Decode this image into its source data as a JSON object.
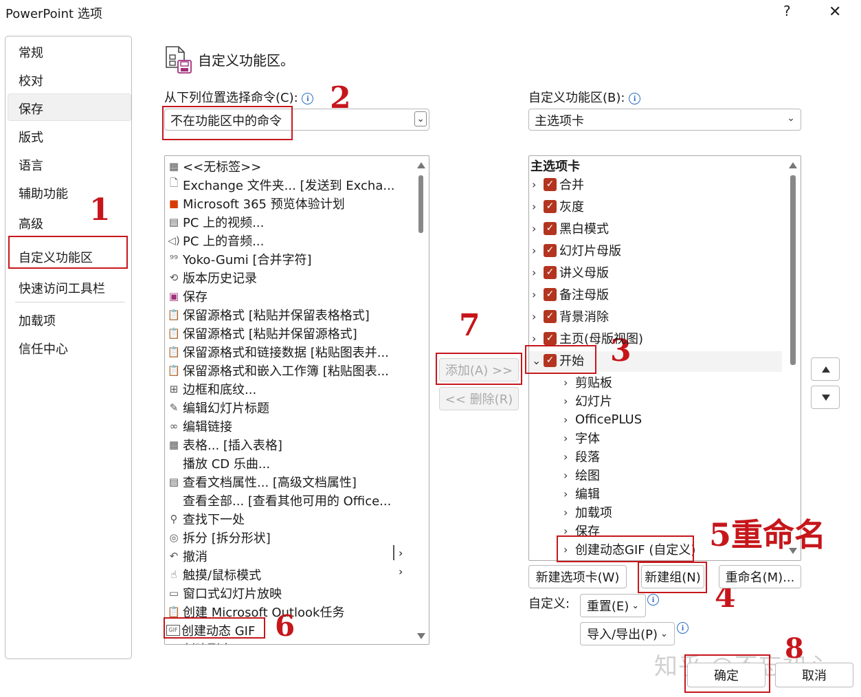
{
  "window": {
    "title": "PowerPoint 选项",
    "help_glyph": "?",
    "close_glyph": "✕"
  },
  "nav": {
    "items": [
      "常规",
      "校对",
      "保存",
      "版式",
      "语言",
      "辅助功能",
      "高级",
      "自定义功能区",
      "快速访问工具栏",
      "加载项",
      "信任中心"
    ]
  },
  "header": {
    "title": "自定义功能区。"
  },
  "left": {
    "choose_label": "从下列位置选择命令(C):",
    "choose_value": "不在功能区中的命令",
    "commands": [
      {
        "icon": "label-icon",
        "glyph": "▦",
        "text": "<<无标签>>"
      },
      {
        "icon": "exchange-icon",
        "glyph": "🗋",
        "text": "Exchange 文件夹... [发送到 Excha..."
      },
      {
        "icon": "office-icon",
        "glyph": "■",
        "text": "Microsoft 365 预览体验计划"
      },
      {
        "icon": "video-icon",
        "glyph": "▤",
        "text": "PC 上的视频..."
      },
      {
        "icon": "audio-icon",
        "glyph": "◁)",
        "text": "PC 上的音频..."
      },
      {
        "icon": "yoko-icon",
        "glyph": "⁹⁹",
        "text": "Yoko-Gumi [合并字符]"
      },
      {
        "icon": "history-icon",
        "glyph": "⟲",
        "text": "版本历史记录"
      },
      {
        "icon": "save-icon",
        "glyph": "▣",
        "text": "保存"
      },
      {
        "icon": "paste-icon",
        "glyph": "📋",
        "text": "保留源格式 [粘贴并保留表格格式]"
      },
      {
        "icon": "paste-icon",
        "glyph": "📋",
        "text": "保留源格式 [粘贴并保留源格式]"
      },
      {
        "icon": "paste-icon",
        "glyph": "📋",
        "text": "保留源格式和链接数据 [粘贴图表并..."
      },
      {
        "icon": "paste-icon",
        "glyph": "📋",
        "text": "保留源格式和嵌入工作簿 [粘贴图表..."
      },
      {
        "icon": "border-icon",
        "glyph": "⊞",
        "text": "边框和底纹..."
      },
      {
        "icon": "edit-title-icon",
        "glyph": "✎",
        "text": "编辑幻灯片标题"
      },
      {
        "icon": "link-icon",
        "glyph": "∞",
        "text": "编辑链接"
      },
      {
        "icon": "table-icon",
        "glyph": "▦",
        "text": "表格... [插入表格]"
      },
      {
        "icon": "none",
        "glyph": "",
        "text": "播放 CD 乐曲..."
      },
      {
        "icon": "properties-icon",
        "glyph": "▤",
        "text": "查看文档属性... [高级文档属性]"
      },
      {
        "icon": "none",
        "glyph": "",
        "text": "查看全部... [查看其他可用的 Office..."
      },
      {
        "icon": "find-icon",
        "glyph": "⚲",
        "text": "查找下一处"
      },
      {
        "icon": "ungroup-icon",
        "glyph": "◎",
        "text": "拆分 [拆分形状]"
      },
      {
        "icon": "undo-icon",
        "glyph": "↶",
        "text": "撤消"
      },
      {
        "icon": "touch-icon",
        "glyph": "☝",
        "text": "触摸/鼠标模式"
      },
      {
        "icon": "slideshow-icon",
        "glyph": "▭",
        "text": "窗口式幻灯片放映"
      },
      {
        "icon": "outlook-task-icon",
        "glyph": "📋",
        "text": "创建 Microsoft Outlook任务"
      },
      {
        "icon": "gif-icon",
        "glyph": "GIF",
        "text": "创建动态 GIF"
      },
      {
        "icon": "none",
        "glyph": "",
        "text": "创建副本"
      }
    ]
  },
  "middle": {
    "add_label": "添加(A) >>",
    "remove_label": "<< 删除(R)"
  },
  "right": {
    "customize_label": "自定义功能区(B):",
    "customize_value": "主选项卡",
    "tree_header": "主选项卡",
    "tabs": [
      "合并",
      "灰度",
      "黑白模式",
      "幻灯片母版",
      "讲义母版",
      "备注母版",
      "背景消除",
      "主页(母版视图)",
      "开始"
    ],
    "groups": [
      "剪贴板",
      "幻灯片",
      "OfficePLUS",
      "字体",
      "段落",
      "绘图",
      "编辑",
      "加载项",
      "保存",
      "创建动态GIF (自定义)"
    ],
    "new_tab": "新建选项卡(W)",
    "new_group": "新建组(N)",
    "rename": "重命名(M)...",
    "customize_caption": "自定义:",
    "reset": "重置(E)",
    "import_export": "导入/导出(P)"
  },
  "footer": {
    "ok": "确定",
    "cancel": "取消"
  },
  "annotations": {
    "n1": "1",
    "n2": "2",
    "n3": "3",
    "n4": "4",
    "n5": "5重命名",
    "n6": "6",
    "n7": "7",
    "n8": "8"
  },
  "watermark": "知乎 @不忘初心",
  "colors": {
    "accent_red": "#c6161b",
    "checkbox": "#b3341f",
    "info_blue": "#2b6cc4"
  }
}
